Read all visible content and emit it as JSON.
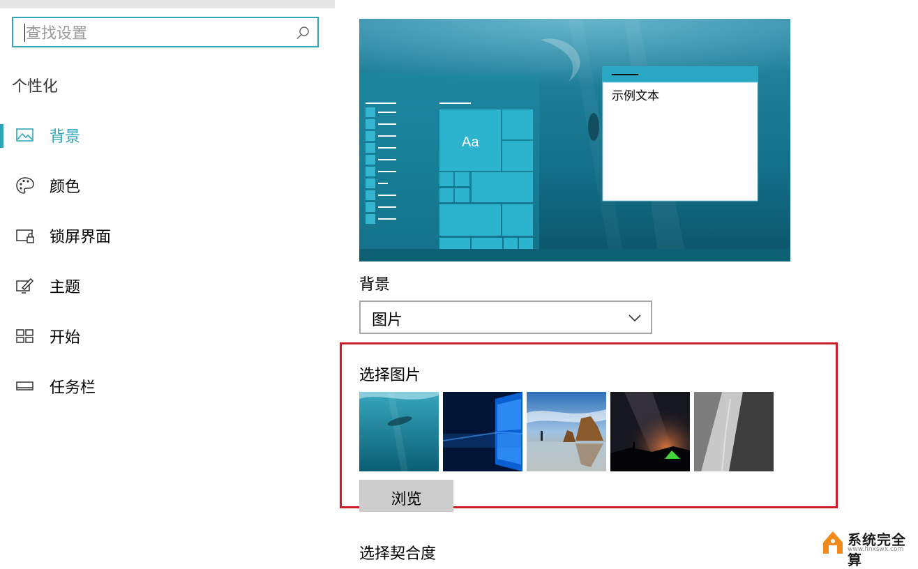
{
  "search": {
    "placeholder": "查找设置"
  },
  "sidebar": {
    "section_title": "个性化",
    "items": [
      {
        "label": "背景",
        "icon": "picture-icon",
        "selected": true
      },
      {
        "label": "颜色",
        "icon": "palette-icon",
        "selected": false
      },
      {
        "label": "锁屏界面",
        "icon": "lock-screen-icon",
        "selected": false
      },
      {
        "label": "主题",
        "icon": "theme-icon",
        "selected": false
      },
      {
        "label": "开始",
        "icon": "start-icon",
        "selected": false
      },
      {
        "label": "任务栏",
        "icon": "taskbar-icon",
        "selected": false
      }
    ]
  },
  "preview": {
    "sample_text": "示例文本",
    "tile_text": "Aa"
  },
  "background": {
    "label": "背景",
    "dropdown_value": "图片"
  },
  "choose_picture": {
    "label": "选择图片",
    "browse_label": "浏览",
    "thumbnails": [
      "underwater-swimmer",
      "windows-10-blue",
      "beach-rocks-sunset",
      "milky-way-tent",
      "rock-cliff-climber"
    ]
  },
  "fit": {
    "label": "选择契合度"
  },
  "watermark": {
    "text": "系统完全算",
    "sub": "www.hnxswx.com"
  },
  "colors": {
    "accent": "#2fa6b8",
    "highlight": "#cc1f2a"
  }
}
